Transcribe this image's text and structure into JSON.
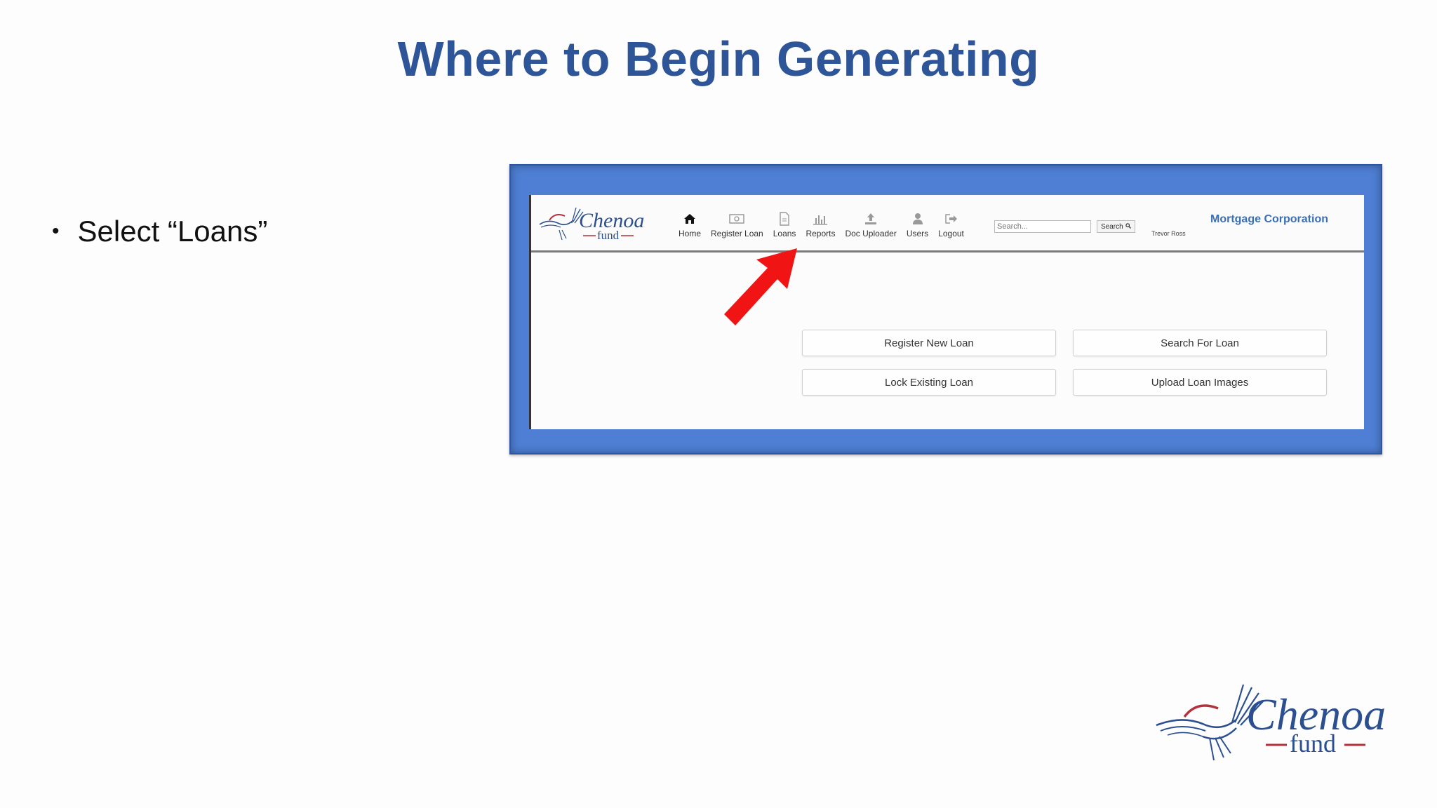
{
  "slide": {
    "title": "Where to Begin Generating",
    "bullets": [
      {
        "text": "Select “Loans”"
      }
    ]
  },
  "app": {
    "logo": {
      "text_main": "Chenoa",
      "text_sub": "fund"
    },
    "nav": [
      {
        "label": "Home",
        "icon": "home-icon"
      },
      {
        "label": "Register Loan",
        "icon": "money-icon"
      },
      {
        "label": "Loans",
        "icon": "document-icon"
      },
      {
        "label": "Reports",
        "icon": "bar-chart-icon"
      },
      {
        "label": "Doc Uploader",
        "icon": "upload-icon"
      },
      {
        "label": "Users",
        "icon": "user-icon"
      },
      {
        "label": "Logout",
        "icon": "logout-icon"
      }
    ],
    "search": {
      "placeholder": "Search...",
      "button_label": "Search"
    },
    "user_name": "Trevor Ross",
    "company": "Mortgage Corporation",
    "actions": [
      {
        "label": "Register New Loan"
      },
      {
        "label": "Search For Loan"
      },
      {
        "label": "Lock Existing Loan"
      },
      {
        "label": "Upload Loan Images"
      }
    ]
  },
  "footer_logo": {
    "text_main": "Chenoa",
    "text_sub": "fund"
  },
  "colors": {
    "title": "#2e5597",
    "frame": "#4e7fd4",
    "company": "#3a6fb8",
    "arrow": "#f01414"
  }
}
